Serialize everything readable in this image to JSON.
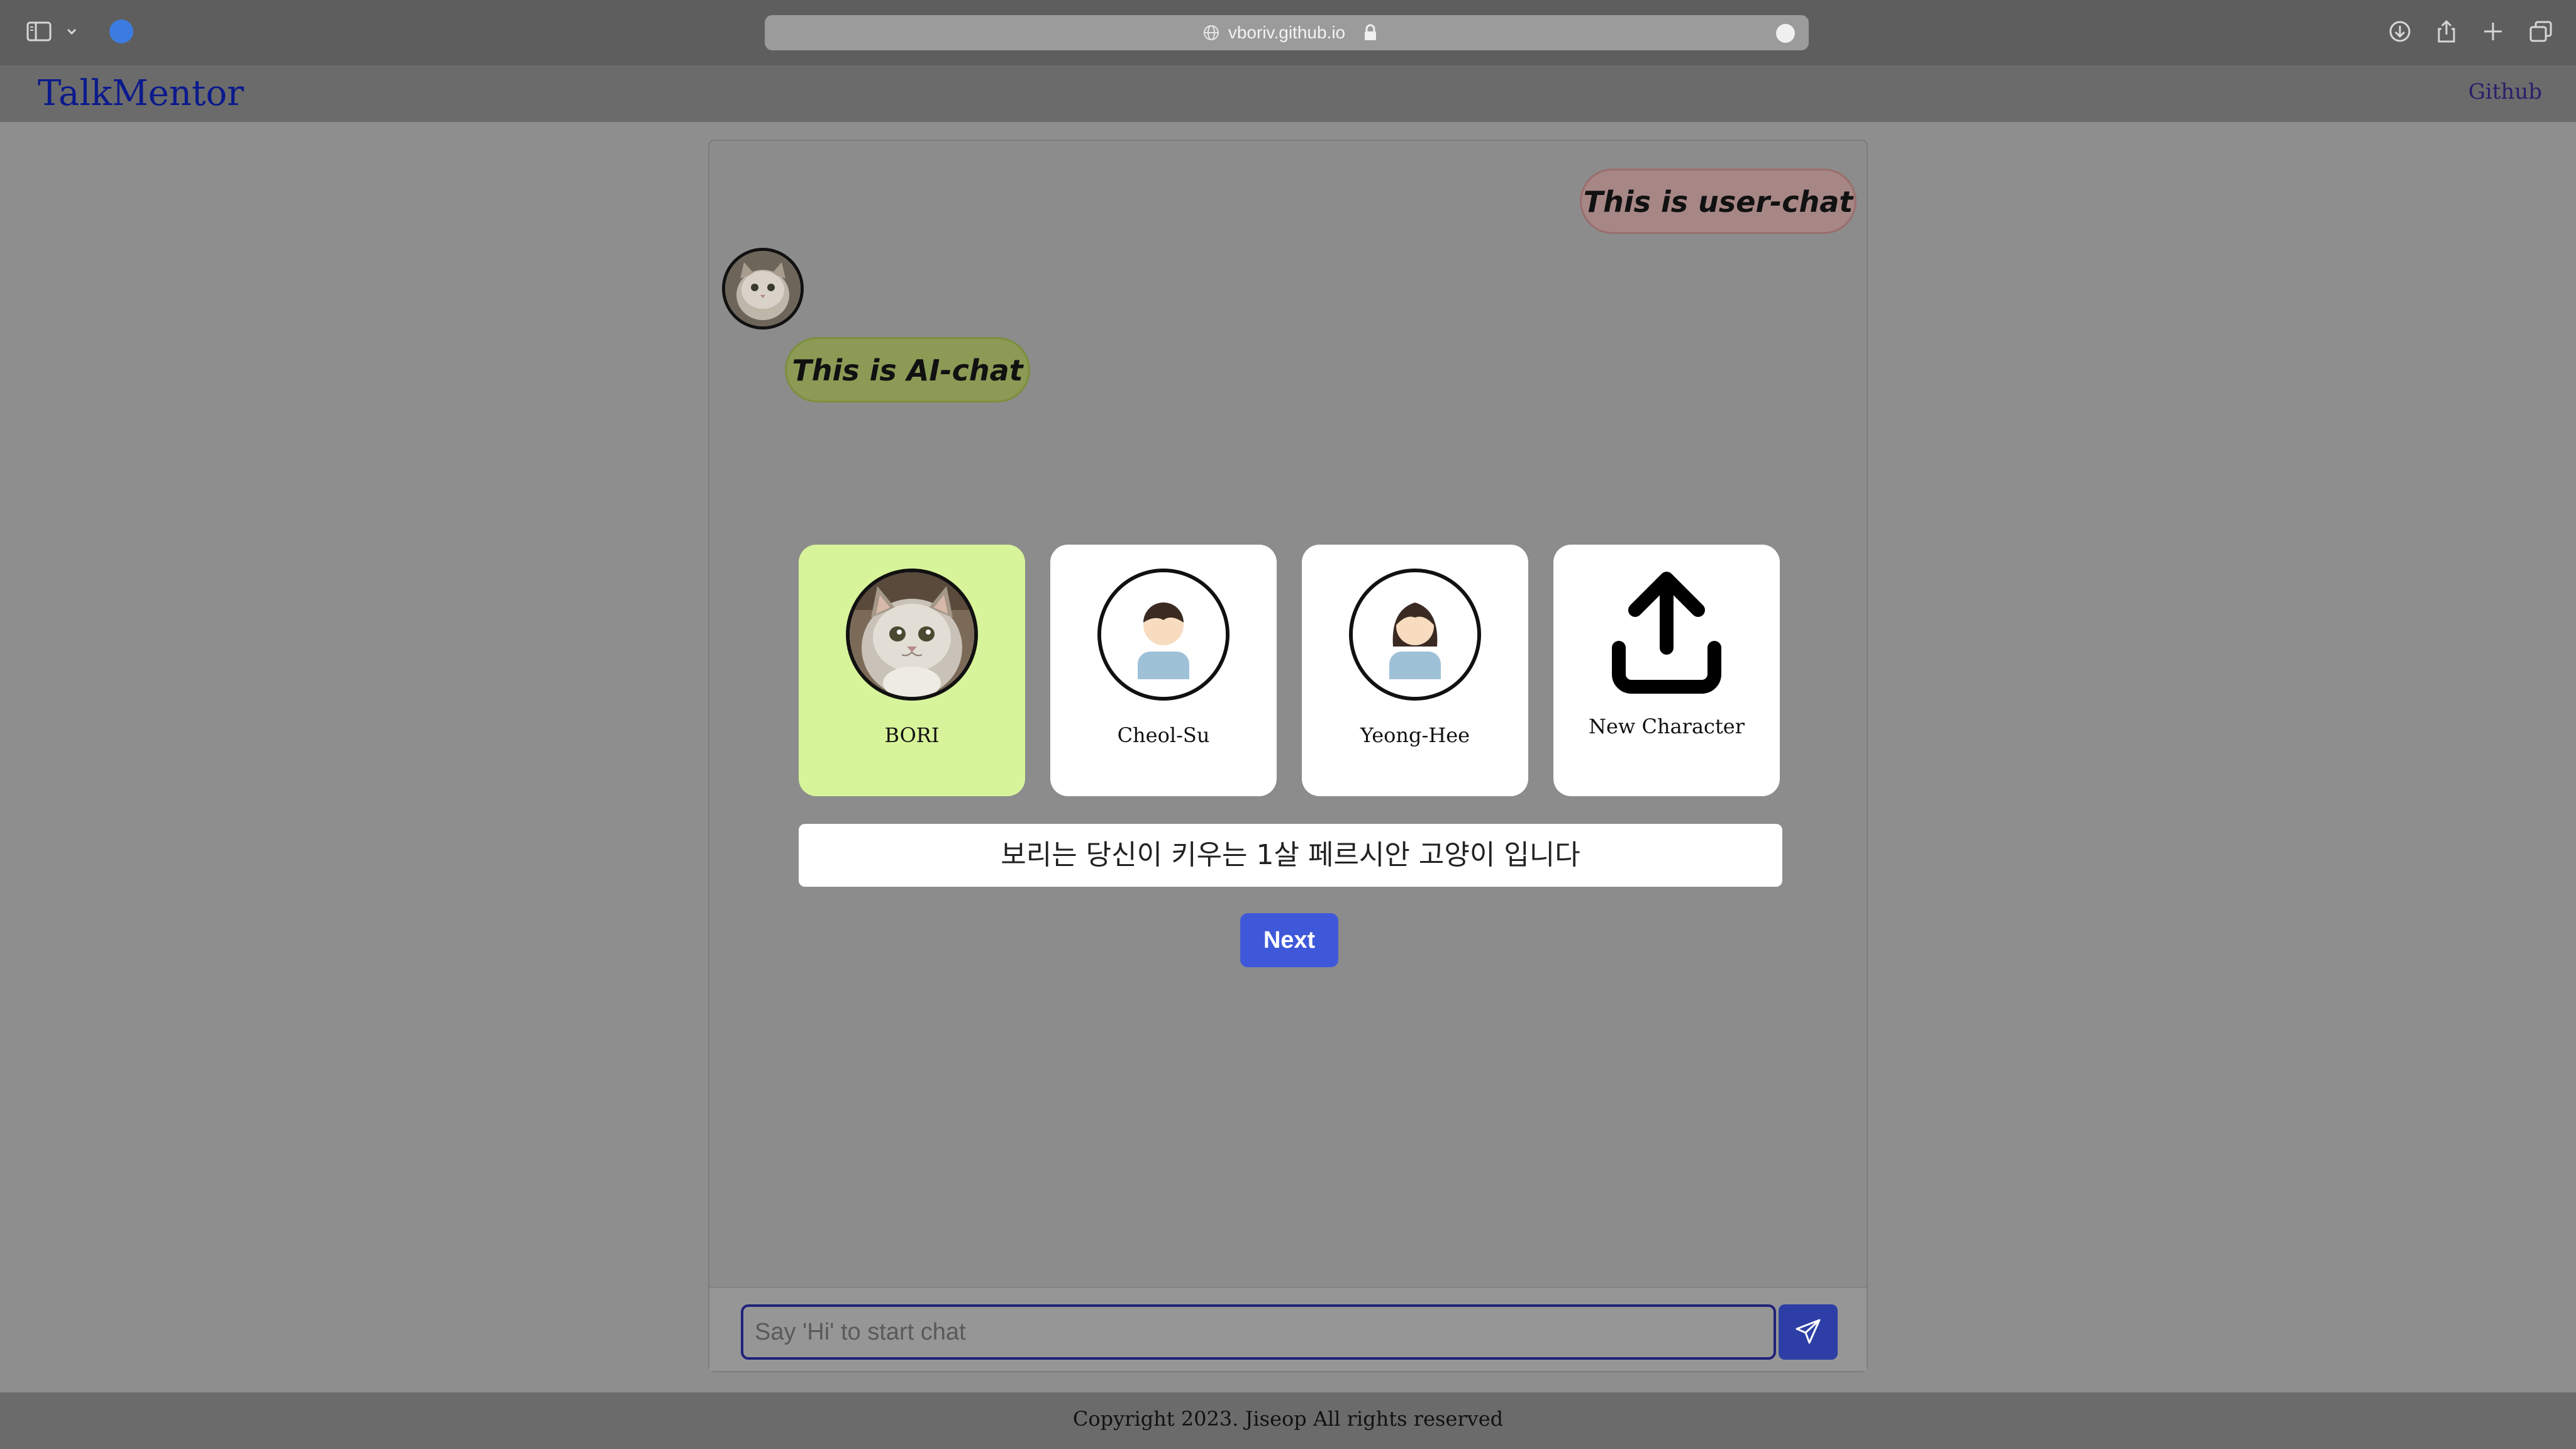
{
  "browser": {
    "url": "vboriv.github.io"
  },
  "header": {
    "brand": "TalkMentor",
    "github_link": "Github"
  },
  "chat": {
    "user_message": "This is user-chat",
    "ai_message": "This is AI-chat"
  },
  "characters": [
    {
      "name": "BORI",
      "avatar": "cat-photo",
      "selected": true
    },
    {
      "name": "Cheol-Su",
      "avatar": "boy-person-icon",
      "selected": false
    },
    {
      "name": "Yeong-Hee",
      "avatar": "girl-person-icon",
      "selected": false
    },
    {
      "name": "New Character",
      "avatar": "upload-icon",
      "selected": false
    }
  ],
  "character_description": "보리는 당신이 키우는 1살 페르시안 고양이 입니다",
  "next_button": "Next",
  "input": {
    "placeholder": "Say 'Hi' to start chat",
    "value": ""
  },
  "footer": {
    "copyright": "Copyright 2023. Jiseop All rights reserved"
  },
  "colors": {
    "accent": "#3f58d9",
    "selected_card": "#d8f49a",
    "user_bubble": "#a78786",
    "ai_bubble": "#8b9b56",
    "brand": "#0b1a8c"
  }
}
